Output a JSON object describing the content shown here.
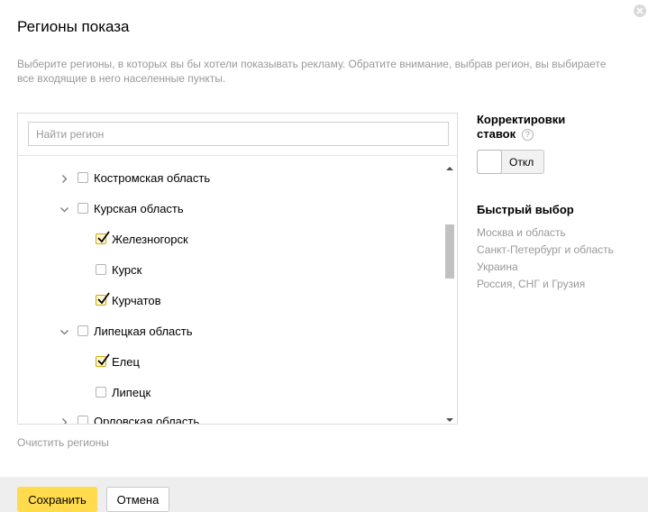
{
  "dialog": {
    "title": "Регионы показа",
    "description": "Выберите регионы, в которых вы бы хотели показывать рекламу. Обратите внимание, выбрав регион, вы выбираете все входящие в него населенные пункты."
  },
  "search": {
    "placeholder": "Найти регион",
    "value": ""
  },
  "tree": {
    "items": [
      {
        "label": "Костромская область",
        "expanded": false,
        "checked": false,
        "level": 1
      },
      {
        "label": "Курская область",
        "expanded": true,
        "checked": false,
        "level": 1
      },
      {
        "label": "Железногорск",
        "checked": true,
        "level": 2
      },
      {
        "label": "Курск",
        "checked": false,
        "level": 2
      },
      {
        "label": "Курчатов",
        "checked": true,
        "level": 2
      },
      {
        "label": "Липецкая область",
        "expanded": true,
        "checked": false,
        "level": 1
      },
      {
        "label": "Елец",
        "checked": true,
        "level": 2
      },
      {
        "label": "Липецк",
        "checked": false,
        "level": 2
      },
      {
        "label": "Орловская область",
        "expanded": false,
        "checked": false,
        "level": 1
      }
    ]
  },
  "clear_regions": "Очистить регионы",
  "bid_adjustments": {
    "heading_line1": "Корректировки",
    "heading_line2": "ставок",
    "help_icon": "?",
    "toggle_label": "Откл"
  },
  "quick_select": {
    "heading": "Быстрый выбор",
    "items": [
      "Москва и область",
      "Санкт-Петербург и область",
      "Украина",
      "Россия, СНГ и Грузия"
    ]
  },
  "footer": {
    "save_label": "Сохранить",
    "cancel_label": "Отмена"
  },
  "colors": {
    "accent": "#ffdb4d",
    "checkbox_checked": "#d6a600",
    "muted_text": "#999999",
    "footer_bg": "#eeeeee"
  },
  "icons": {
    "close": "close-icon",
    "expand": "chevron-right-icon",
    "collapse": "chevron-down-icon",
    "check": "checkmark-icon",
    "help": "question-icon"
  }
}
